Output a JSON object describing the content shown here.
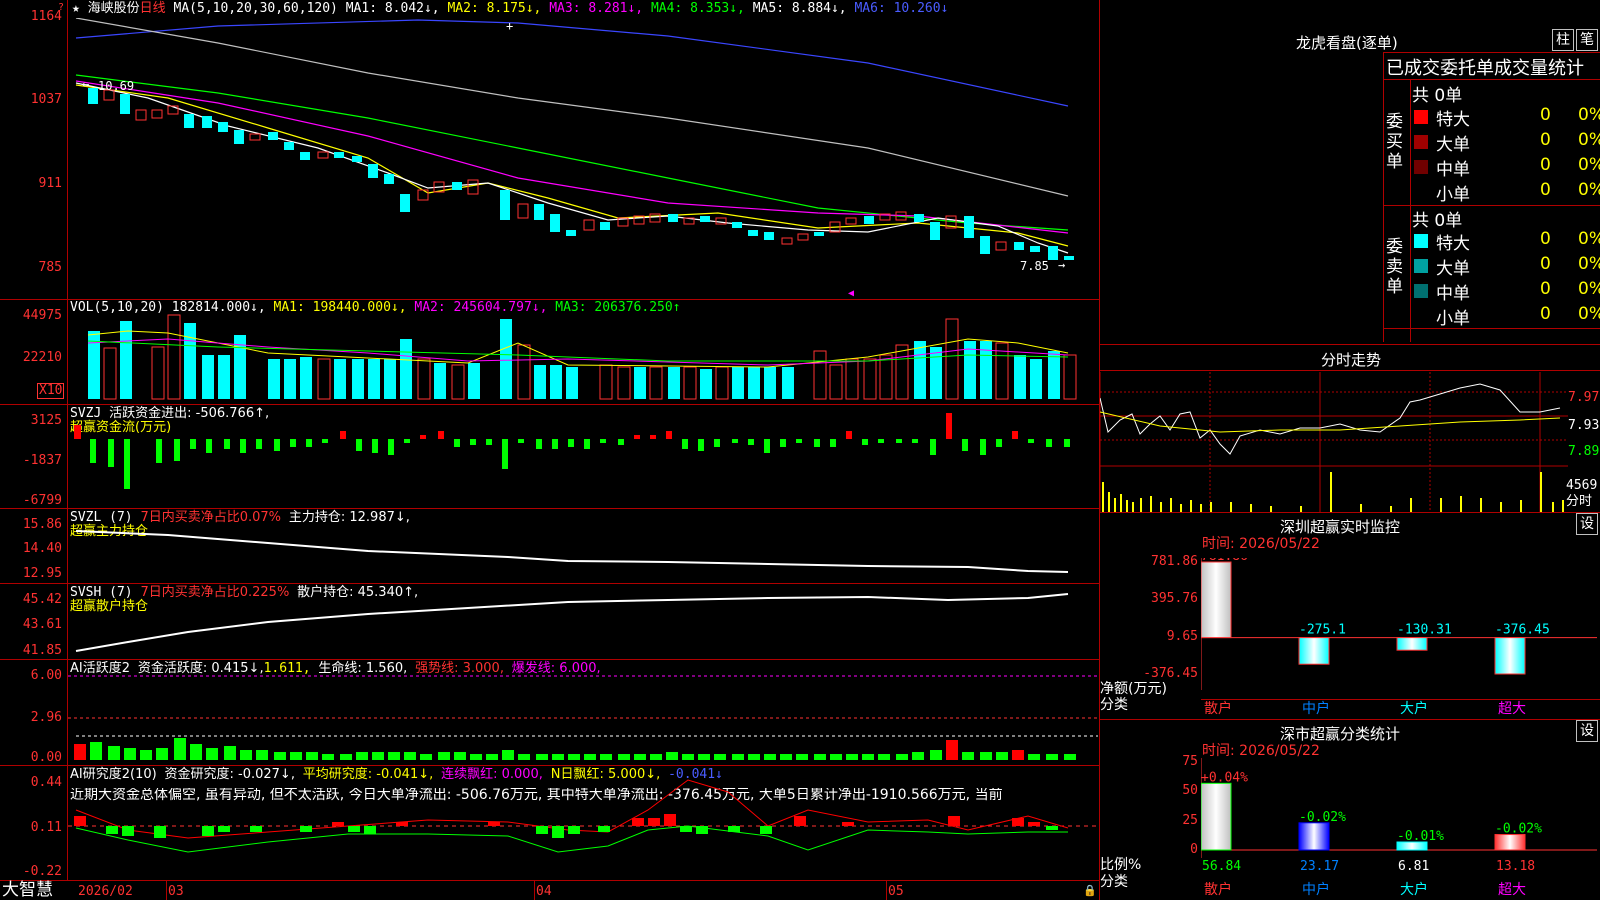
{
  "header": {
    "icons": "★ ",
    "stock_name": "海峡股份",
    "period": "日线",
    "ma_spec": "MA(5,10,20,30,60,120)",
    "ma1": "MA1: 8.042↓,",
    "ma2": "MA2: 8.175↓,",
    "ma3": "MA3: 8.281↓,",
    "ma4": "MA4: 8.353↓,",
    "ma5": "MA5: 8.884↓,",
    "ma6": "MA6: 10.260↓"
  },
  "main_axis": [
    "1164",
    "1037",
    "911",
    "785"
  ],
  "main_annotations": {
    "high": "10.69",
    "low": "7.85"
  },
  "vol": {
    "label": "VOL(5,10,20)",
    "val": "182814.000↓,",
    "ma1": "MA1: 198440.000↓,",
    "ma2": "MA2: 245604.797↓,",
    "ma3": "MA3: 206376.250↑",
    "axis": [
      "44975",
      "22210"
    ],
    "unit": "X10"
  },
  "svzj": {
    "label": "SVZJ",
    "text": "活跃资金进出: -506.766↑,",
    "sub": "超赢资金流(万元)",
    "axis": [
      "3125",
      "-1837",
      "-6799"
    ]
  },
  "svzl": {
    "label": "SVZL (7)",
    "text1": "7日内买卖净占比0.07%",
    "text2": "主力持仓: 12.987↓,",
    "sub": "超赢主力持仓",
    "axis": [
      "15.86",
      "14.40",
      "12.95"
    ]
  },
  "svsh": {
    "label": "SVSH (7)",
    "text1": "7日内买卖净占比0.225%",
    "text2": "散户持仓: 45.340↑,",
    "sub": "超赢散户持仓",
    "axis": [
      "45.42",
      "43.61",
      "41.85"
    ]
  },
  "ai1": {
    "label": "AI活跃度2",
    "t1": "资金活跃度: 0.415↓,",
    "t2": "1.611,",
    "t3": "生命线: 1.560,",
    "t4": "强势线: 3.000,",
    "t5": "爆发线: 6.000,",
    "axis": [
      "6.00",
      "2.96",
      "0.00"
    ]
  },
  "ai2": {
    "label": "AI研究度2(10)",
    "t1": "资金研究度: -0.027↓,",
    "t2": "平均研究度: -0.041↓,",
    "t3": "连续飘红: 0.000,",
    "t4": "N日飘红: 5.000↓,",
    "t5": "-0.041↓",
    "note": "近期大资金总体偏空, 虽有异动, 但不太活跃, 今日大单净流出: -506.76万元, 其中特大单净流出: -376.45万元, 大单5日累计净出-1910.566万元, 当前",
    "axis": [
      "0.44",
      "0.11",
      "-0.22"
    ]
  },
  "date_axis": {
    "brand": "大智慧",
    "labels": [
      "2026/02",
      "03",
      "04",
      "05"
    ]
  },
  "dragon": {
    "title": "龙虎看盘(逐单)",
    "btn1": "柱",
    "btn2": "笔",
    "subtitle": "已成交委托单成交量统计",
    "buy_label": "委买单",
    "sell_label": "委卖单",
    "buy_total": "共 0单",
    "sell_total": "共 0单",
    "buy_rows": [
      {
        "name": "特大",
        "vol": "0",
        "pct": "0%",
        "color": "#ff0000"
      },
      {
        "name": "大单",
        "vol": "0",
        "pct": "0%",
        "color": "#a00000"
      },
      {
        "name": "中单",
        "vol": "0",
        "pct": "0%",
        "color": "#700000"
      },
      {
        "name": "小单",
        "vol": "0",
        "pct": "0%",
        "color": "#000000"
      }
    ],
    "sell_rows": [
      {
        "name": "特大",
        "vol": "0",
        "pct": "0%",
        "color": "#00ffff"
      },
      {
        "name": "大单",
        "vol": "0",
        "pct": "0%",
        "color": "#00a0a0"
      },
      {
        "name": "中单",
        "vol": "0",
        "pct": "0%",
        "color": "#007070"
      },
      {
        "name": "小单",
        "vol": "0",
        "pct": "0%",
        "color": "#000000"
      }
    ]
  },
  "intraday": {
    "title": "分时走势",
    "price_axis": [
      "7.97",
      "7.93",
      "7.89"
    ],
    "vol_axis": "4569",
    "vol_unit": "分时"
  },
  "monitor": {
    "title": "深圳超赢实时监控",
    "btn": "设",
    "time": "时间: 2026/05/22",
    "axis": [
      "781.86",
      "395.76",
      "9.65",
      "-376.45"
    ],
    "ylabel": "净额(万元)",
    "xlabel": "分类",
    "cats": [
      "散户",
      "中户",
      "大户",
      "超大"
    ],
    "values": [
      781.86,
      -275.1,
      -130.31,
      -376.45
    ],
    "labels": [
      "781.86",
      "-275.1",
      "-130.31",
      "-376.45"
    ]
  },
  "category": {
    "title": "深市超赢分类统计",
    "btn": "设",
    "time": "时间: 2026/05/22",
    "axis": [
      "75",
      "50",
      "25",
      "0"
    ],
    "ylabel": "比例%",
    "xlabel": "分类",
    "cats": [
      "散户",
      "中户",
      "大户",
      "超大"
    ],
    "values": [
      56.84,
      23.17,
      6.81,
      13.18
    ],
    "value_labels": [
      "56.84",
      "23.17",
      "6.81",
      "13.18"
    ],
    "change_labels": [
      "+0.04%",
      "-0.02%",
      "-0.01%",
      "-0.02%"
    ]
  }
}
